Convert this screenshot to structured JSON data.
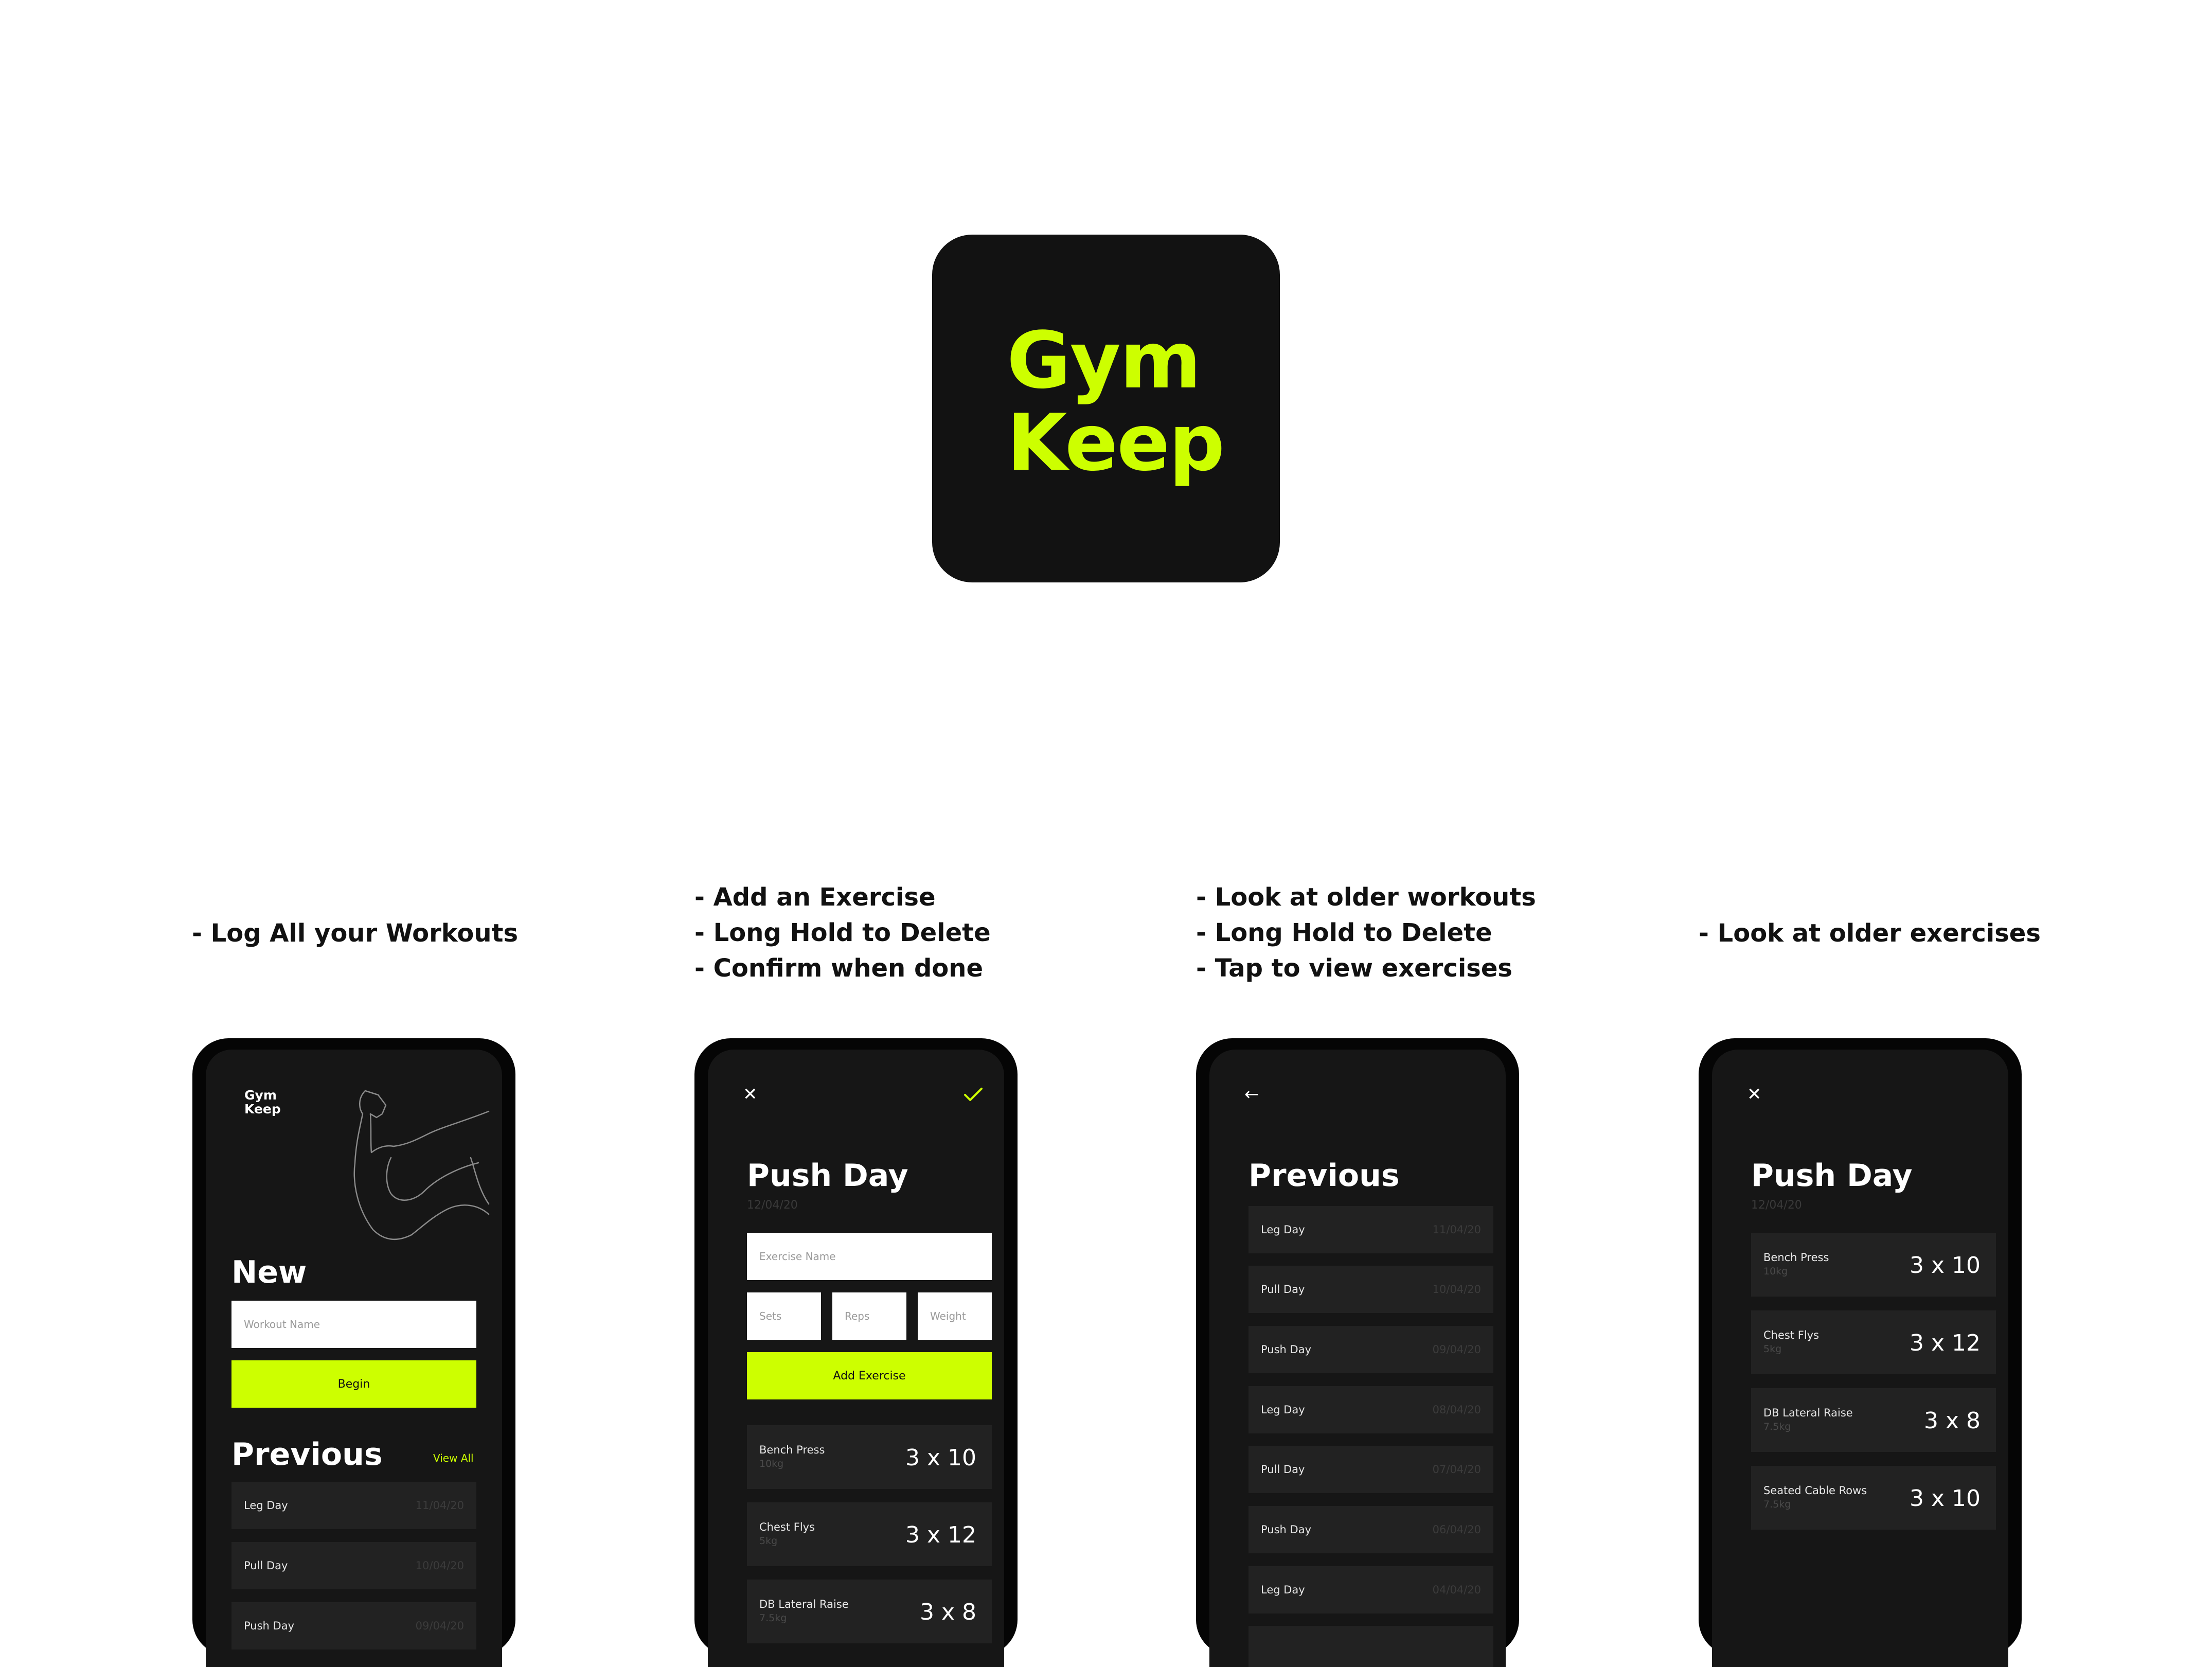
{
  "app_icon": {
    "line1": "Gym",
    "line2": "Keep"
  },
  "features": [
    {
      "lines": [
        "- Log All your Workouts"
      ]
    },
    {
      "lines": [
        "- Add an Exercise",
        "- Long Hold to Delete",
        "- Confirm when done"
      ]
    },
    {
      "lines": [
        "- Look at older workouts",
        "- Long Hold to Delete",
        "- Tap to view exercises"
      ]
    },
    {
      "lines": [
        "- Look at older exercises"
      ]
    }
  ],
  "screen1": {
    "logo_line1": "Gym",
    "logo_line2": "Keep",
    "new_title": "New",
    "workout_placeholder": "Workout Name",
    "begin_label": "Begin",
    "previous_title": "Previous",
    "view_all_label": "View All",
    "items": [
      {
        "name": "Leg Day",
        "date": "11/04/20"
      },
      {
        "name": "Pull Day",
        "date": "10/04/20"
      },
      {
        "name": "Push Day",
        "date": "09/04/20"
      }
    ]
  },
  "screen2": {
    "title": "Push Day",
    "date": "12/04/20",
    "exercise_placeholder": "Exercise Name",
    "sets_placeholder": "Sets",
    "reps_placeholder": "Reps",
    "weight_placeholder": "Weight",
    "add_label": "Add Exercise",
    "items": [
      {
        "name": "Bench Press",
        "weight": "10kg",
        "sets_reps": "3 x 10"
      },
      {
        "name": "Chest Flys",
        "weight": "5kg",
        "sets_reps": "3 x 12"
      },
      {
        "name": "DB Lateral Raise",
        "weight": "7.5kg",
        "sets_reps": "3 x 8"
      }
    ]
  },
  "screen3": {
    "title": "Previous",
    "items": [
      {
        "name": "Leg Day",
        "date": "11/04/20"
      },
      {
        "name": "Pull Day",
        "date": "10/04/20"
      },
      {
        "name": "Push Day",
        "date": "09/04/20"
      },
      {
        "name": "Leg Day",
        "date": "08/04/20"
      },
      {
        "name": "Pull Day",
        "date": "07/04/20"
      },
      {
        "name": "Push Day",
        "date": "06/04/20"
      },
      {
        "name": "Leg Day",
        "date": "04/04/20"
      }
    ]
  },
  "screen4": {
    "title": "Push Day",
    "date": "12/04/20",
    "items": [
      {
        "name": "Bench Press",
        "weight": "10kg",
        "sets_reps": "3 x 10"
      },
      {
        "name": "Chest Flys",
        "weight": "5kg",
        "sets_reps": "3 x 12"
      },
      {
        "name": "DB Lateral Raise",
        "weight": "7.5kg",
        "sets_reps": "3 x 8"
      },
      {
        "name": "Seated Cable Rows",
        "weight": "7.5kg",
        "sets_reps": "3 x 10"
      }
    ]
  },
  "icons": {
    "close": "close-icon",
    "check": "check-icon",
    "back": "arrow-left-icon",
    "illustration": "flexed-arm-illustration"
  },
  "colors": {
    "accent": "#cdff00",
    "background": "#161616",
    "card": "#222222"
  }
}
